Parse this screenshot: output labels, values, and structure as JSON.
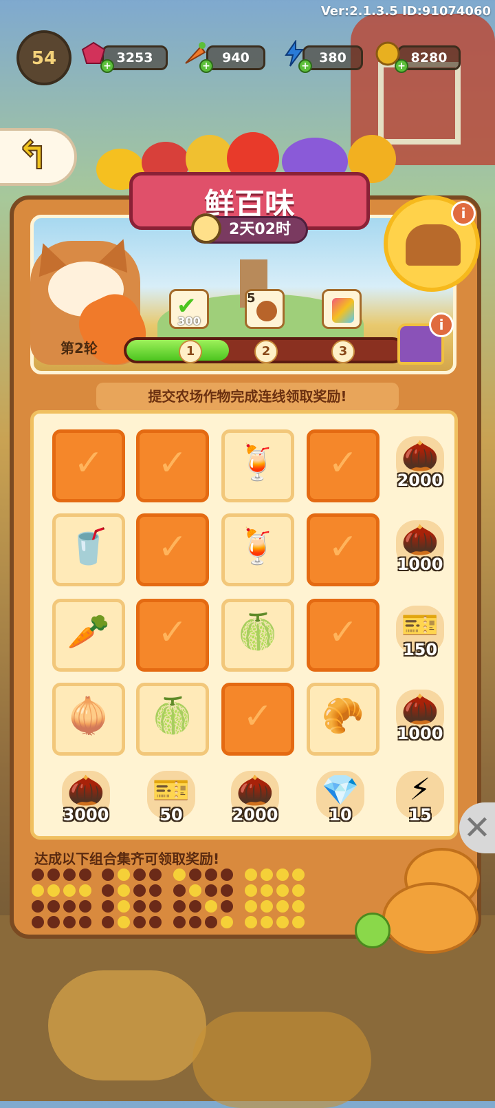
{
  "version": "Ver:2.1.3.5 ID:91074060",
  "player": {
    "level": "54"
  },
  "resources": [
    {
      "name": "gem-icon",
      "value": "3253",
      "color": "#d2325a"
    },
    {
      "name": "carrot-icon",
      "value": "940",
      "color": "#f07a2a"
    },
    {
      "name": "energy-icon",
      "value": "380",
      "color": "#2a7bd8"
    },
    {
      "name": "coin-icon",
      "value": "8280",
      "color": "#e8b020"
    }
  ],
  "event": {
    "title": "鲜百味",
    "timer": "2天02时",
    "round": "第2轮",
    "milestones": [
      {
        "step": "1",
        "reward": "300",
        "completed": true
      },
      {
        "step": "2",
        "reward": "5",
        "completed": false
      },
      {
        "step": "3",
        "reward": "",
        "completed": false
      }
    ],
    "progress_fraction": 0.37,
    "hint": "提交农场作物完成连线领取奖励!",
    "combo_hint": "达成以下组合集齐可领取奖励!"
  },
  "grid": [
    [
      {
        "type": "done"
      },
      {
        "type": "done"
      },
      {
        "type": "item",
        "icon": "lemonade-icon",
        "glyph": "🍹"
      },
      {
        "type": "done"
      }
    ],
    [
      {
        "type": "item",
        "icon": "apple-juice-icon",
        "glyph": "🥤"
      },
      {
        "type": "done"
      },
      {
        "type": "item",
        "icon": "lemonade-icon",
        "glyph": "🍹"
      },
      {
        "type": "done"
      }
    ],
    [
      {
        "type": "item",
        "icon": "radish-icon",
        "glyph": "🥕"
      },
      {
        "type": "done"
      },
      {
        "type": "item",
        "icon": "melon-icon",
        "glyph": "🍈"
      },
      {
        "type": "done"
      }
    ],
    [
      {
        "type": "item",
        "icon": "onion-ring-icon",
        "glyph": "🧅"
      },
      {
        "type": "item",
        "icon": "melon-icon",
        "glyph": "🍈"
      },
      {
        "type": "done"
      },
      {
        "type": "item",
        "icon": "baked-tray-icon",
        "glyph": "🥐"
      }
    ]
  ],
  "row_rewards": [
    {
      "icon": "sunflower-seed-icon",
      "glyph": "🌰",
      "value": "2000"
    },
    {
      "icon": "sunflower-seed-icon",
      "glyph": "🌰",
      "value": "1000"
    },
    {
      "icon": "ticket-icon",
      "glyph": "🎫",
      "value": "150"
    },
    {
      "icon": "sunflower-seed-icon",
      "glyph": "🌰",
      "value": "1000"
    }
  ],
  "col_rewards": [
    {
      "icon": "sunflower-seeds-icon",
      "glyph": "🌰",
      "value": "3000"
    },
    {
      "icon": "ticket-icon",
      "glyph": "🎫",
      "value": "50"
    },
    {
      "icon": "sunflower-seed-icon",
      "glyph": "🌰",
      "value": "2000"
    },
    {
      "icon": "gem-cluster-icon",
      "glyph": "💎",
      "value": "10"
    },
    {
      "icon": "energy-icon",
      "glyph": "⚡",
      "value": "15"
    }
  ],
  "combos": [
    [
      0,
      0,
      0,
      0,
      1,
      1,
      1,
      1,
      0,
      0,
      0,
      0,
      0,
      0,
      0,
      0
    ],
    [
      0,
      1,
      0,
      0,
      0,
      1,
      0,
      0,
      0,
      1,
      0,
      0,
      0,
      1,
      0,
      0
    ],
    [
      1,
      0,
      0,
      0,
      0,
      1,
      0,
      0,
      0,
      0,
      1,
      0,
      0,
      0,
      0,
      1
    ],
    [
      1,
      1,
      1,
      1,
      1,
      1,
      1,
      1,
      1,
      1,
      1,
      1,
      1,
      1,
      1,
      1
    ]
  ]
}
